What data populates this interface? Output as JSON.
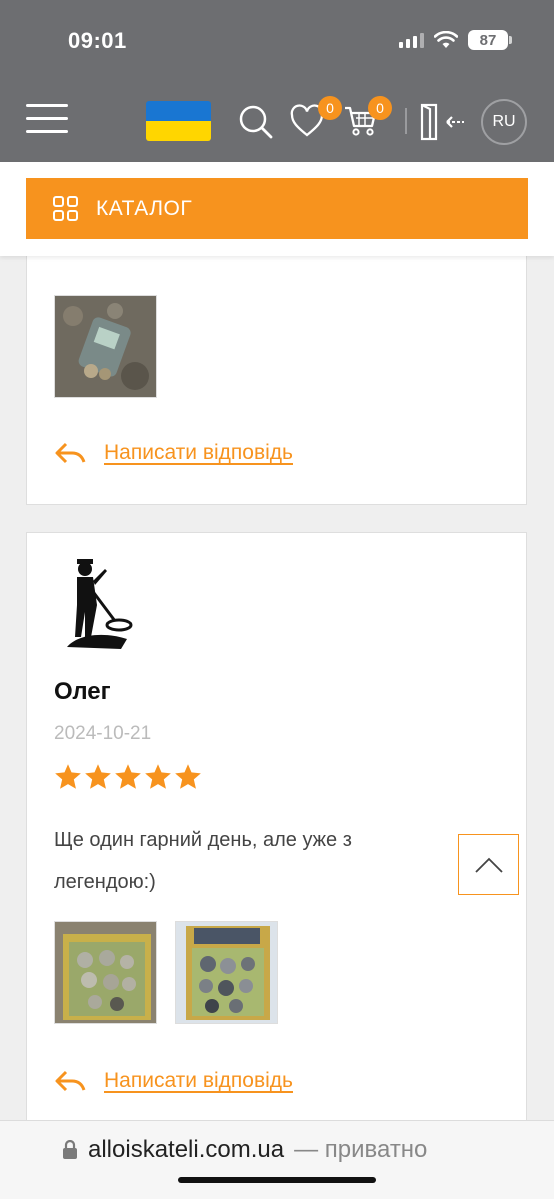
{
  "status_bar": {
    "time": "09:01",
    "battery": "87"
  },
  "header": {
    "wishlist_count": "0",
    "cart_count": "0",
    "language": "RU",
    "catalog_label": "КАТАЛОГ"
  },
  "reviews": [
    {
      "reply_label": "Написати відповідь"
    },
    {
      "name": "Олег",
      "date": "2024-10-21",
      "rating": 5,
      "comment": "Ще один гарний день, але уже з легендою:)",
      "reply_label": "Написати відповідь"
    }
  ],
  "browser": {
    "domain": "alloiskateli.com.ua",
    "privacy": "— приватно"
  },
  "colors": {
    "accent": "#f7931e",
    "header_bg": "#6d6e71"
  }
}
